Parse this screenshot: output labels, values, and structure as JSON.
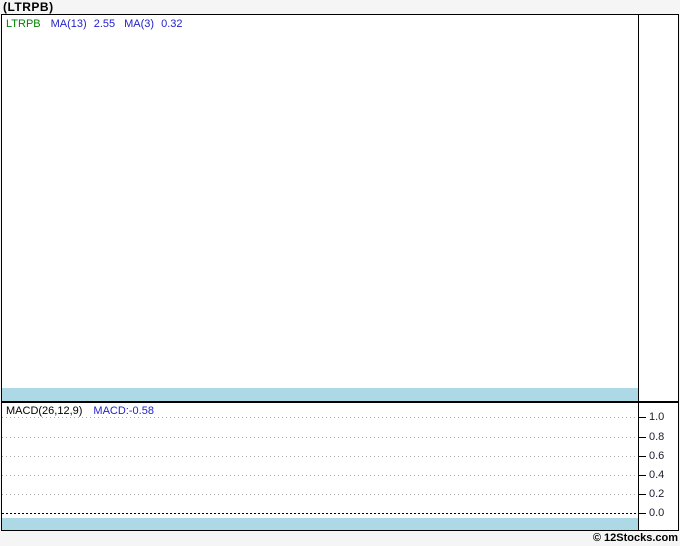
{
  "page": {
    "title": "(LTRPB)",
    "copyright": "© 12Stocks.com"
  },
  "colors": {
    "highlight_band": "#add8e6",
    "symbol_green": "#008000",
    "indicator_blue": "#2222cc",
    "grid_gray": "#aaaaaa",
    "frame_border": "#000000",
    "page_background": "#f5f5f5",
    "panel_background": "#ffffff"
  },
  "price_panel": {
    "legend": {
      "symbol": "LTRPB",
      "ma13_label": "MA(13)",
      "ma13_value": "2.55",
      "ma3_label": "MA(3)",
      "ma3_value": "0.32"
    }
  },
  "macd_panel": {
    "legend": {
      "indicator_label": "MACD(26,12,9)",
      "indicator_value": "MACD:-0.58"
    },
    "ticks": [
      "1.0",
      "0.8",
      "0.6",
      "0.4",
      "0.2",
      "0.0"
    ]
  },
  "chart_data": [
    {
      "type": "line",
      "title": "LTRPB price panel",
      "series": [
        {
          "name": "LTRPB",
          "color": "#008000",
          "values": []
        },
        {
          "name": "MA(13)",
          "last_value": 2.55,
          "values": []
        },
        {
          "name": "MA(3)",
          "last_value": 0.32,
          "values": []
        }
      ],
      "legend_position": "top-left",
      "grid": false,
      "annotations": [
        "panel is empty except a lightblue highlight band along the bottom; no price curve, axis labels or x-axis labels are rendered"
      ]
    },
    {
      "type": "line",
      "title": "MACD(26,12,9)",
      "series": [
        {
          "name": "MACD",
          "last_value": -0.58,
          "values": []
        }
      ],
      "yticks": [
        1.0,
        0.8,
        0.6,
        0.4,
        0.2,
        0.0
      ],
      "ylim": [
        -0.18,
        1.16
      ],
      "grid": true,
      "legend_position": "top-left",
      "annotations": [
        "dotted gray gridlines at 0.2 intervals; dense dotted black line at 0.0; MACD line itself not visible within displayed range; lightblue highlight band along the bottom"
      ]
    }
  ]
}
